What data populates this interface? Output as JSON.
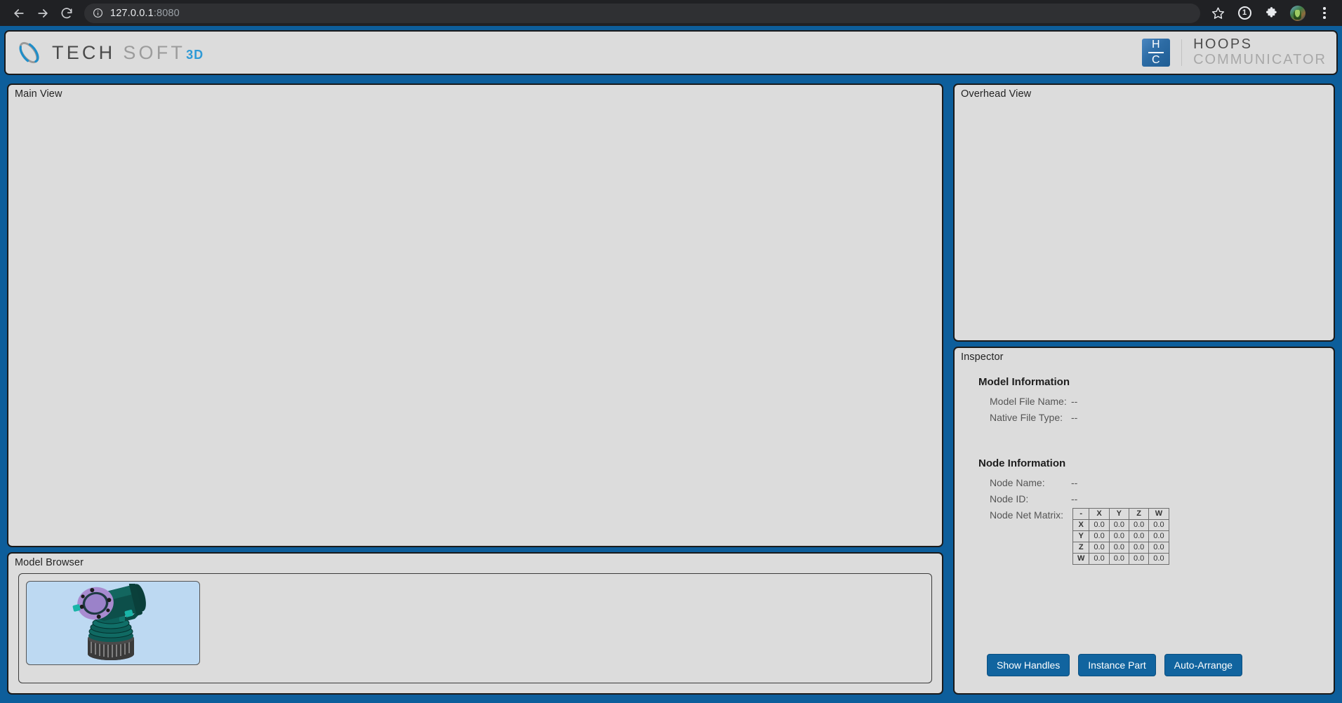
{
  "browser": {
    "back_icon": "arrow-left-icon",
    "forward_icon": "arrow-right-icon",
    "reload_icon": "reload-icon",
    "site_info_icon": "info-circle-icon",
    "url_host": "127.0.0.1",
    "url_port": ":8080",
    "bookmark_icon": "star-icon",
    "update_badge": "1",
    "extensions_icon": "puzzle-icon",
    "profile_icon": "avatar",
    "menu_icon": "kebab-menu-icon"
  },
  "header": {
    "brand_mark": "techsoft-orbit-logo",
    "brand_tech": "TECH",
    "brand_soft": "SOFT",
    "brand_3d": "3D",
    "product_badge_top": "H",
    "product_badge_bottom": "C",
    "product_line1": "HOOPS",
    "product_line2": "COMMUNICATOR"
  },
  "panels": {
    "main_view_title": "Main View",
    "overhead_view_title": "Overhead View",
    "model_browser_title": "Model Browser",
    "inspector_title": "Inspector"
  },
  "model_browser": {
    "thumbnail_name": "valve-assembly-thumbnail"
  },
  "inspector": {
    "model_information_heading": "Model Information",
    "model_file_name_label": "Model File Name:",
    "model_file_name_value": "--",
    "native_file_type_label": "Native File Type:",
    "native_file_type_value": "--",
    "node_information_heading": "Node Information",
    "node_name_label": "Node Name:",
    "node_name_value": "--",
    "node_id_label": "Node ID:",
    "node_id_value": "--",
    "node_net_matrix_label": "Node Net Matrix:",
    "matrix": {
      "columns": [
        "-",
        "X",
        "Y",
        "Z",
        "W"
      ],
      "rows": [
        {
          "label": "X",
          "values": [
            "0.0",
            "0.0",
            "0.0",
            "0.0"
          ]
        },
        {
          "label": "Y",
          "values": [
            "0.0",
            "0.0",
            "0.0",
            "0.0"
          ]
        },
        {
          "label": "Z",
          "values": [
            "0.0",
            "0.0",
            "0.0",
            "0.0"
          ]
        },
        {
          "label": "W",
          "values": [
            "0.0",
            "0.0",
            "0.0",
            "0.0"
          ]
        }
      ]
    },
    "buttons": [
      {
        "label": "Show Handles",
        "name": "show-handles-button"
      },
      {
        "label": "Instance Part",
        "name": "instance-part-button"
      },
      {
        "label": "Auto-Arrange",
        "name": "auto-arrange-button"
      }
    ]
  },
  "colors": {
    "frame_blue": "#0d5e9b",
    "panel_gray": "#dcdcdc",
    "button_blue": "#11649f",
    "thumbnail_bg": "#bdd9f2",
    "accent_cyan": "#2f9ad6"
  }
}
